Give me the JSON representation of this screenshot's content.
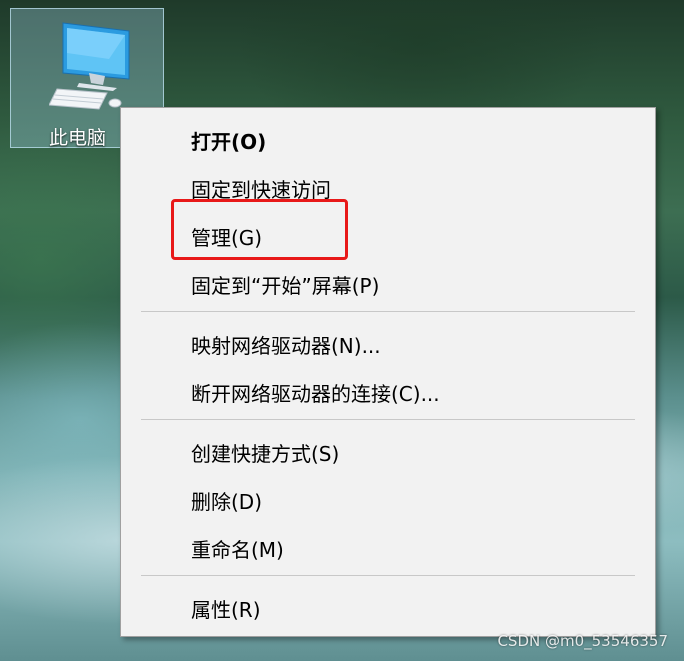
{
  "desktop": {
    "icon_label": "此电脑",
    "icon": "computer-icon"
  },
  "context_menu": {
    "open": "打开(O)",
    "pin_quick_access": "固定到快速访问",
    "manage": "管理(G)",
    "pin_start": "固定到“开始”屏幕(P)",
    "map_drive": "映射网络驱动器(N)...",
    "disconnect_drive": "断开网络驱动器的连接(C)...",
    "create_shortcut": "创建快捷方式(S)",
    "delete": "删除(D)",
    "rename": "重命名(M)",
    "properties": "属性(R)"
  },
  "colors": {
    "highlight_box": "#e81919",
    "menu_background": "#f2f2f2"
  },
  "watermark": "CSDN @m0_53546357"
}
